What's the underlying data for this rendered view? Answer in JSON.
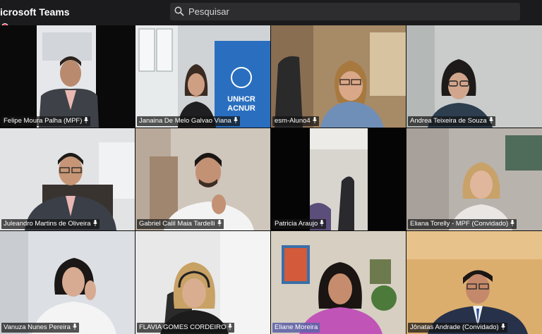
{
  "app": {
    "title": "icrosoft Teams"
  },
  "search": {
    "placeholder": "Pesquisar"
  },
  "colors": {
    "accent": "#6264a7",
    "recording": "#e23b4a"
  },
  "participants": [
    {
      "name": "Felipe Moura Palha (MPF)",
      "mic_icon": "mic-icon"
    },
    {
      "name": "Janaina De Melo Galvao Viana",
      "mic_icon": "mic-icon",
      "backdrop": "UNHCR ACNUR"
    },
    {
      "name": "esm-Aluno4",
      "mic_icon": "mic-icon"
    },
    {
      "name": "Andrea Teixeira de Souza",
      "mic_icon": "mic-icon"
    },
    {
      "name": "Juleandro Martins de Oliveira",
      "mic_icon": "mic-icon"
    },
    {
      "name": "Gabriel Calil Maia Tardelli",
      "mic_icon": "mic-icon"
    },
    {
      "name": "Patricia Araujo",
      "mic_icon": "mic-icon"
    },
    {
      "name": "Eliana Torelly - MPF (Convidado)",
      "mic_icon": "mic-icon"
    },
    {
      "name": "Vanuza Nunes Pereira",
      "mic_icon": "mic-icon"
    },
    {
      "name": "FLAVIA GOMES CORDEIRO",
      "mic_icon": "mic-icon"
    },
    {
      "name": "Eliane Moreira",
      "mic_icon": "mic-icon",
      "highlighted": true
    },
    {
      "name": "Jônatas Andrade (Convidado)",
      "mic_icon": "mic-icon"
    }
  ]
}
